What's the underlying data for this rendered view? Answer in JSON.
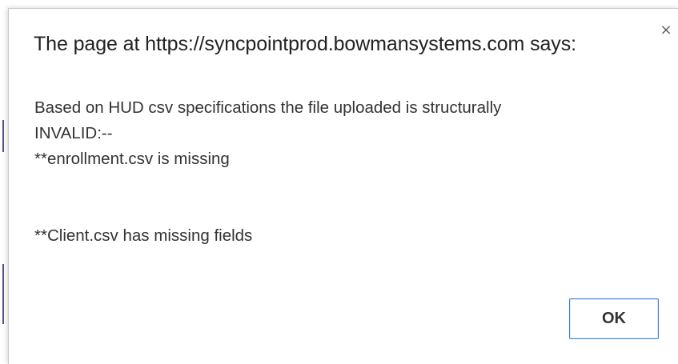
{
  "dialog": {
    "title": "The page at https://syncpointprod.bowmansystems.com says:",
    "close_glyph": "×",
    "message_lines": [
      "Based on HUD csv specifications the file uploaded is structurally",
      "INVALID:--",
      "**enrollment.csv is missing",
      "",
      "",
      "**Client.csv has missing fields"
    ],
    "ok_label": "OK"
  },
  "colors": {
    "button_border": "#3b82d6",
    "title_text": "#222222",
    "body_text": "#333333"
  }
}
